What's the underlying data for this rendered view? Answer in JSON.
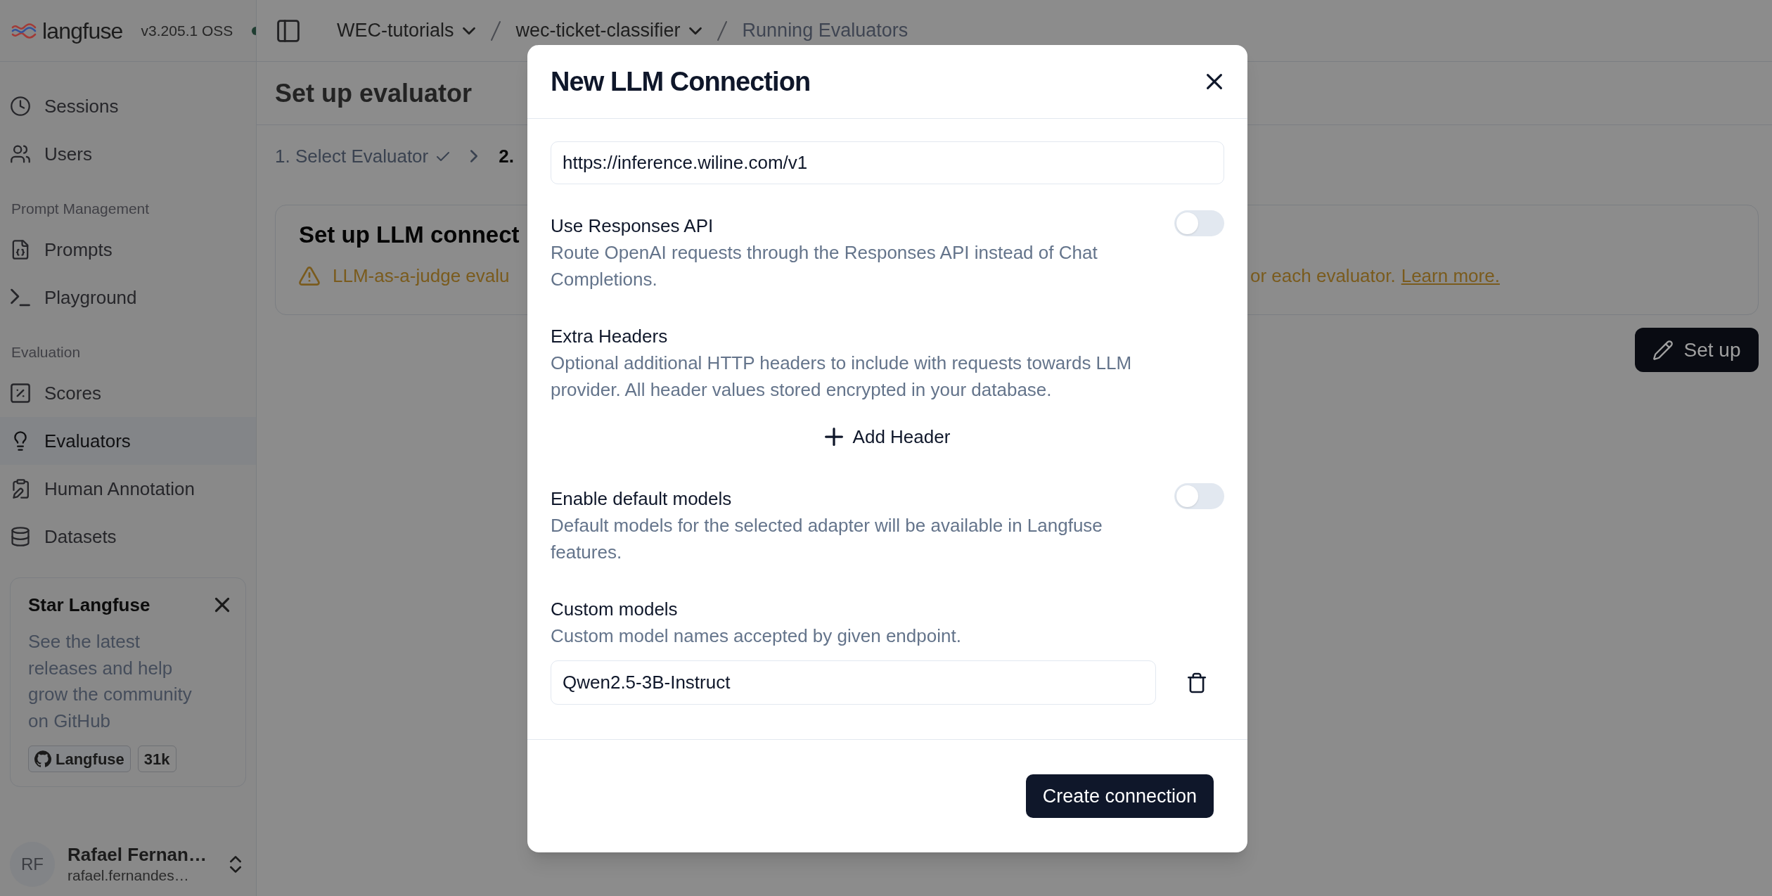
{
  "sidebar": {
    "brand": "langfuse",
    "version": "v3.205.1 OSS",
    "groups": [
      {
        "items": [
          {
            "label": "Sessions",
            "selected": false
          },
          {
            "label": "Users",
            "selected": false
          }
        ]
      },
      {
        "heading": "Prompt Management",
        "items": [
          {
            "label": "Prompts",
            "selected": false
          },
          {
            "label": "Playground",
            "selected": false
          }
        ]
      },
      {
        "heading": "Evaluation",
        "items": [
          {
            "label": "Scores",
            "selected": false
          },
          {
            "label": "Evaluators",
            "selected": true
          },
          {
            "label": "Human Annotation",
            "selected": false
          },
          {
            "label": "Datasets",
            "selected": false
          }
        ]
      }
    ],
    "promo": {
      "title": "Star Langfuse",
      "text": "See the latest releases and help grow the community on GitHub",
      "github_label": "Langfuse",
      "star_count": "31k"
    },
    "user": {
      "initials": "RF",
      "name": "Rafael Fernan…",
      "email": "rafael.fernandes…"
    }
  },
  "breadcrumbs": [
    {
      "label": "WEC-tutorials",
      "menu": true,
      "current": false
    },
    {
      "label": "wec-ticket-classifier",
      "menu": true,
      "current": false
    },
    {
      "label": "Running Evaluators",
      "menu": false,
      "current": true
    }
  ],
  "page": {
    "title": "Set up evaluator",
    "steps": [
      {
        "label": "1. Select Evaluator",
        "done": true,
        "selected": false
      },
      {
        "label": "2.",
        "done": false,
        "selected": true
      }
    ],
    "card": {
      "title": "Set up LLM connect",
      "warning_left": "LLM-as-a-judge evalu",
      "warning_right": "or each evaluator.",
      "link": "Learn more."
    },
    "setup_button": "Set up"
  },
  "modal": {
    "title": "New LLM Connection",
    "sections": [
      {
        "kind": "input",
        "value": "https://inference.wiline.com/v1"
      },
      {
        "kind": "switch",
        "label": "Use Responses API",
        "description": "Route OpenAI requests through the Responses API instead of Chat Completions.",
        "on": false
      },
      {
        "kind": "action",
        "label": "Extra Headers",
        "description": "Optional additional HTTP headers to include with requests towards LLM provider. All header values stored encrypted in your database.",
        "button": "Add Header"
      },
      {
        "kind": "switch",
        "label": "Enable default models",
        "description": "Default models for the selected adapter will be available in Langfuse features.",
        "on": false
      },
      {
        "kind": "list",
        "label": "Custom models",
        "description": "Custom model names accepted by given endpoint.",
        "values": [
          "Qwen2.5-3B-Instruct"
        ]
      }
    ],
    "submit": "Create connection"
  }
}
